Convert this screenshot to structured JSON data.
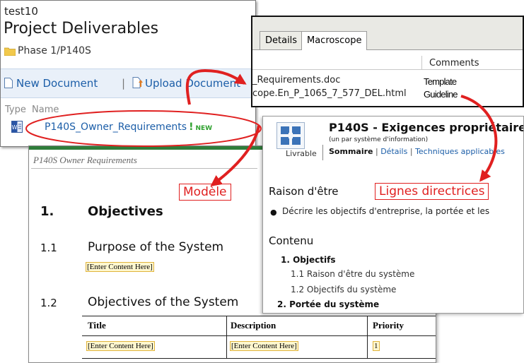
{
  "sharepoint": {
    "site": "test10",
    "title": "Project Deliverables",
    "path": "Phase 1/P140S",
    "new_document": "New Document",
    "separator": "|",
    "upload_document": "Upload Document",
    "columns": {
      "type": "Type",
      "name": "Name"
    },
    "file": {
      "name": "P140S_Owner_Requirements",
      "flag": "!",
      "new_badge": "NEW"
    }
  },
  "tabs_window": {
    "tabs": [
      "Details",
      "Macroscope"
    ],
    "comments_header": "Comments",
    "rows": [
      {
        "name": "_Requirements.doc",
        "comment": "Template"
      },
      {
        "name": "cope.En_P_1065_7_577_DEL.html",
        "comment": "Guideline"
      }
    ]
  },
  "document": {
    "header_title": "P140S Owner Requirements",
    "sections": [
      {
        "number": "1.",
        "title": "Objectives"
      },
      {
        "number": "1.1",
        "title": "Purpose of the System",
        "placeholder": "[Enter Content Here]"
      },
      {
        "number": "1.2",
        "title": "Objectives of the System"
      }
    ],
    "table": {
      "headers": [
        "Title",
        "Description",
        "Priority"
      ],
      "row": [
        "[Enter Content Here]",
        "[Enter Content Here]",
        "1"
      ]
    }
  },
  "livrable": {
    "title": "P140S - Exigences propriétaire",
    "subtitle": "(un par système d'information)",
    "type_label": "Livrable",
    "nav": [
      "Sommaire",
      "Détails",
      "Techniques applicables"
    ],
    "nav_sep": "|",
    "section1_title": "Raison d'être",
    "bullet": "Décrire les objectifs d'entreprise, la portée et les",
    "section2_title": "Contenu",
    "toc": [
      {
        "label": "1. Objectifs",
        "level": 1
      },
      {
        "label": "1.1 Raison d'être du système",
        "level": 2
      },
      {
        "label": "1.2 Objectifs du système",
        "level": 2
      },
      {
        "label": "2. Portée du système",
        "level": 1
      }
    ]
  },
  "callouts": {
    "modele": "Modèle",
    "lignes": "Lignes directrices"
  },
  "colors": {
    "accent_red": "#e02020",
    "link_blue": "#1c5ea8",
    "new_green": "#2ea12e",
    "folder_yellow": "#f2c94c"
  }
}
